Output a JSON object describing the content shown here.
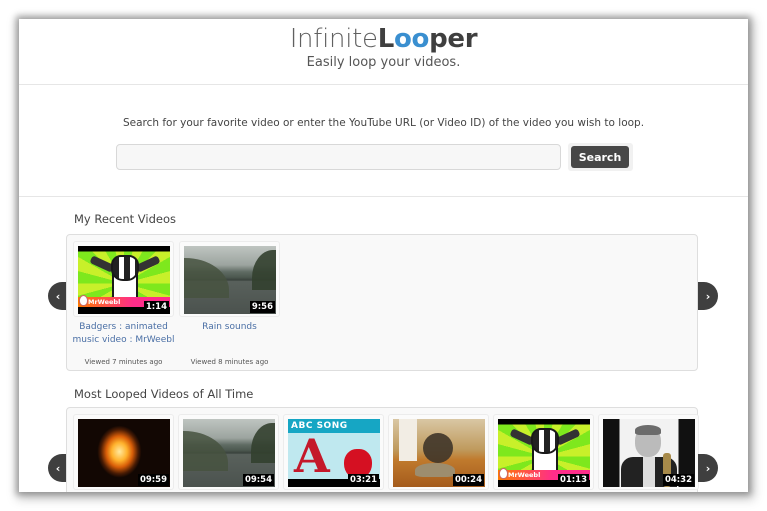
{
  "header": {
    "logo_part1": "Infinite",
    "logo_part2_l": "L",
    "logo_part2_oo": "oo",
    "logo_part2_rest": "per",
    "tagline": "Easily loop your videos."
  },
  "search": {
    "prompt": "Search for your favorite video or enter the YouTube URL (or Video ID) of the video you wish to loop.",
    "input_value": "",
    "placeholder": "",
    "button_label": "Search"
  },
  "recent": {
    "title": "My Recent Videos",
    "prev_icon": "chevron-left-icon",
    "next_icon": "chevron-right-icon",
    "prev_glyph": "‹",
    "next_glyph": "›",
    "videos": [
      {
        "title": "Badgers : animated music video : MrWeebl",
        "duration": "1:14",
        "viewed": "Viewed 7 minutes ago",
        "thumb": "badger",
        "watermark": "MrWeebl"
      },
      {
        "title": "Rain sounds",
        "duration": "9:56",
        "viewed": "Viewed 8 minutes ago",
        "thumb": "rain"
      }
    ]
  },
  "most_looped": {
    "title": "Most Looped Videos of All Time",
    "prev_glyph": "‹",
    "next_glyph": "›",
    "videos": [
      {
        "duration": "09:59",
        "thumb": "fireplace"
      },
      {
        "duration": "09:54",
        "thumb": "rain"
      },
      {
        "duration": "03:21",
        "thumb": "abc-song",
        "overlay_text": "ABC SONG",
        "letter": "A"
      },
      {
        "duration": "00:24",
        "thumb": "tortoise-cat"
      },
      {
        "duration": "01:13",
        "thumb": "badger",
        "watermark": "MrWeebl"
      },
      {
        "duration": "04:32",
        "thumb": "saxophonist"
      }
    ]
  },
  "colors": {
    "accent_blue": "#3a8fd0",
    "link_blue": "#4a6fa5",
    "button_dark": "#474747"
  }
}
